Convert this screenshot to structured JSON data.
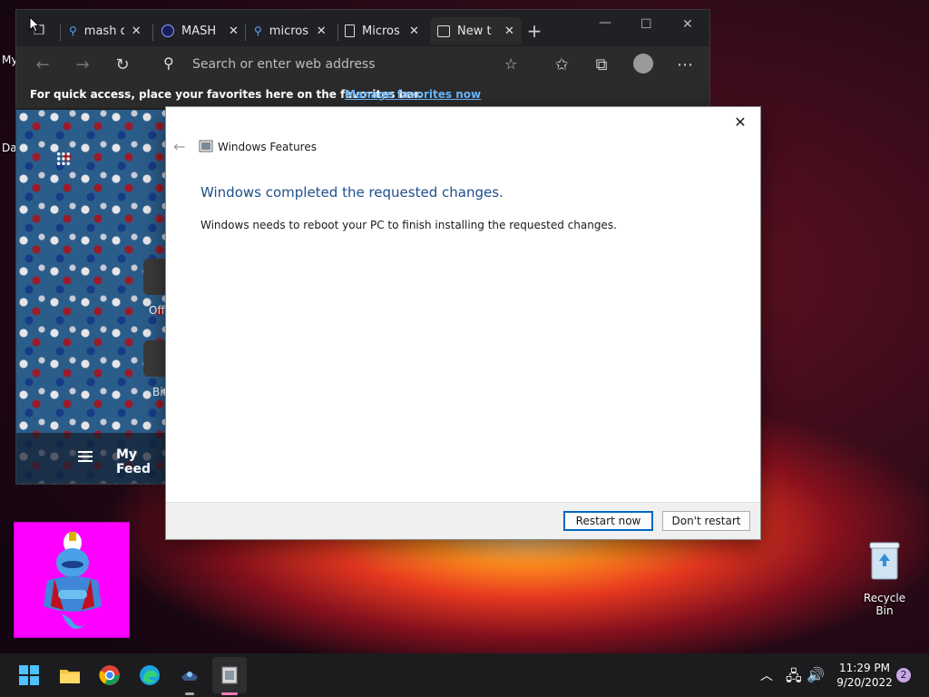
{
  "desktop": {
    "partial_labels": [
      "My",
      "Da"
    ],
    "recycle_bin_label": "Recycle Bin"
  },
  "browser": {
    "tabs": [
      {
        "label": "mash d",
        "icon": "search-icon"
      },
      {
        "label": "MASH",
        "icon": "mash-icon"
      },
      {
        "label": "micros",
        "icon": "search-icon"
      },
      {
        "label": "Micros",
        "icon": "page-icon"
      },
      {
        "label": "New t",
        "icon": "newtab-icon",
        "active": true
      }
    ],
    "address_placeholder": "Search or enter web address",
    "favorites_message": "For quick access, place your favorites here on the favorites bar.",
    "favorites_link": "Manage favorites now",
    "feed_label": "My Feed",
    "tiles": [
      "Offi",
      "Bin"
    ]
  },
  "dialog": {
    "title": "Windows Features",
    "heading": "Windows completed the requested changes.",
    "body": "Windows needs to reboot your PC to finish installing the requested changes.",
    "restart_label": "Restart now",
    "dont_restart_label": "Don't restart"
  },
  "taskbar": {
    "time": "11:29 PM",
    "date": "9/20/2022",
    "notification_count": "2"
  },
  "colors": {
    "accent": "#0067c0",
    "heading": "#1f4e8c",
    "link": "#6cb8ff"
  }
}
